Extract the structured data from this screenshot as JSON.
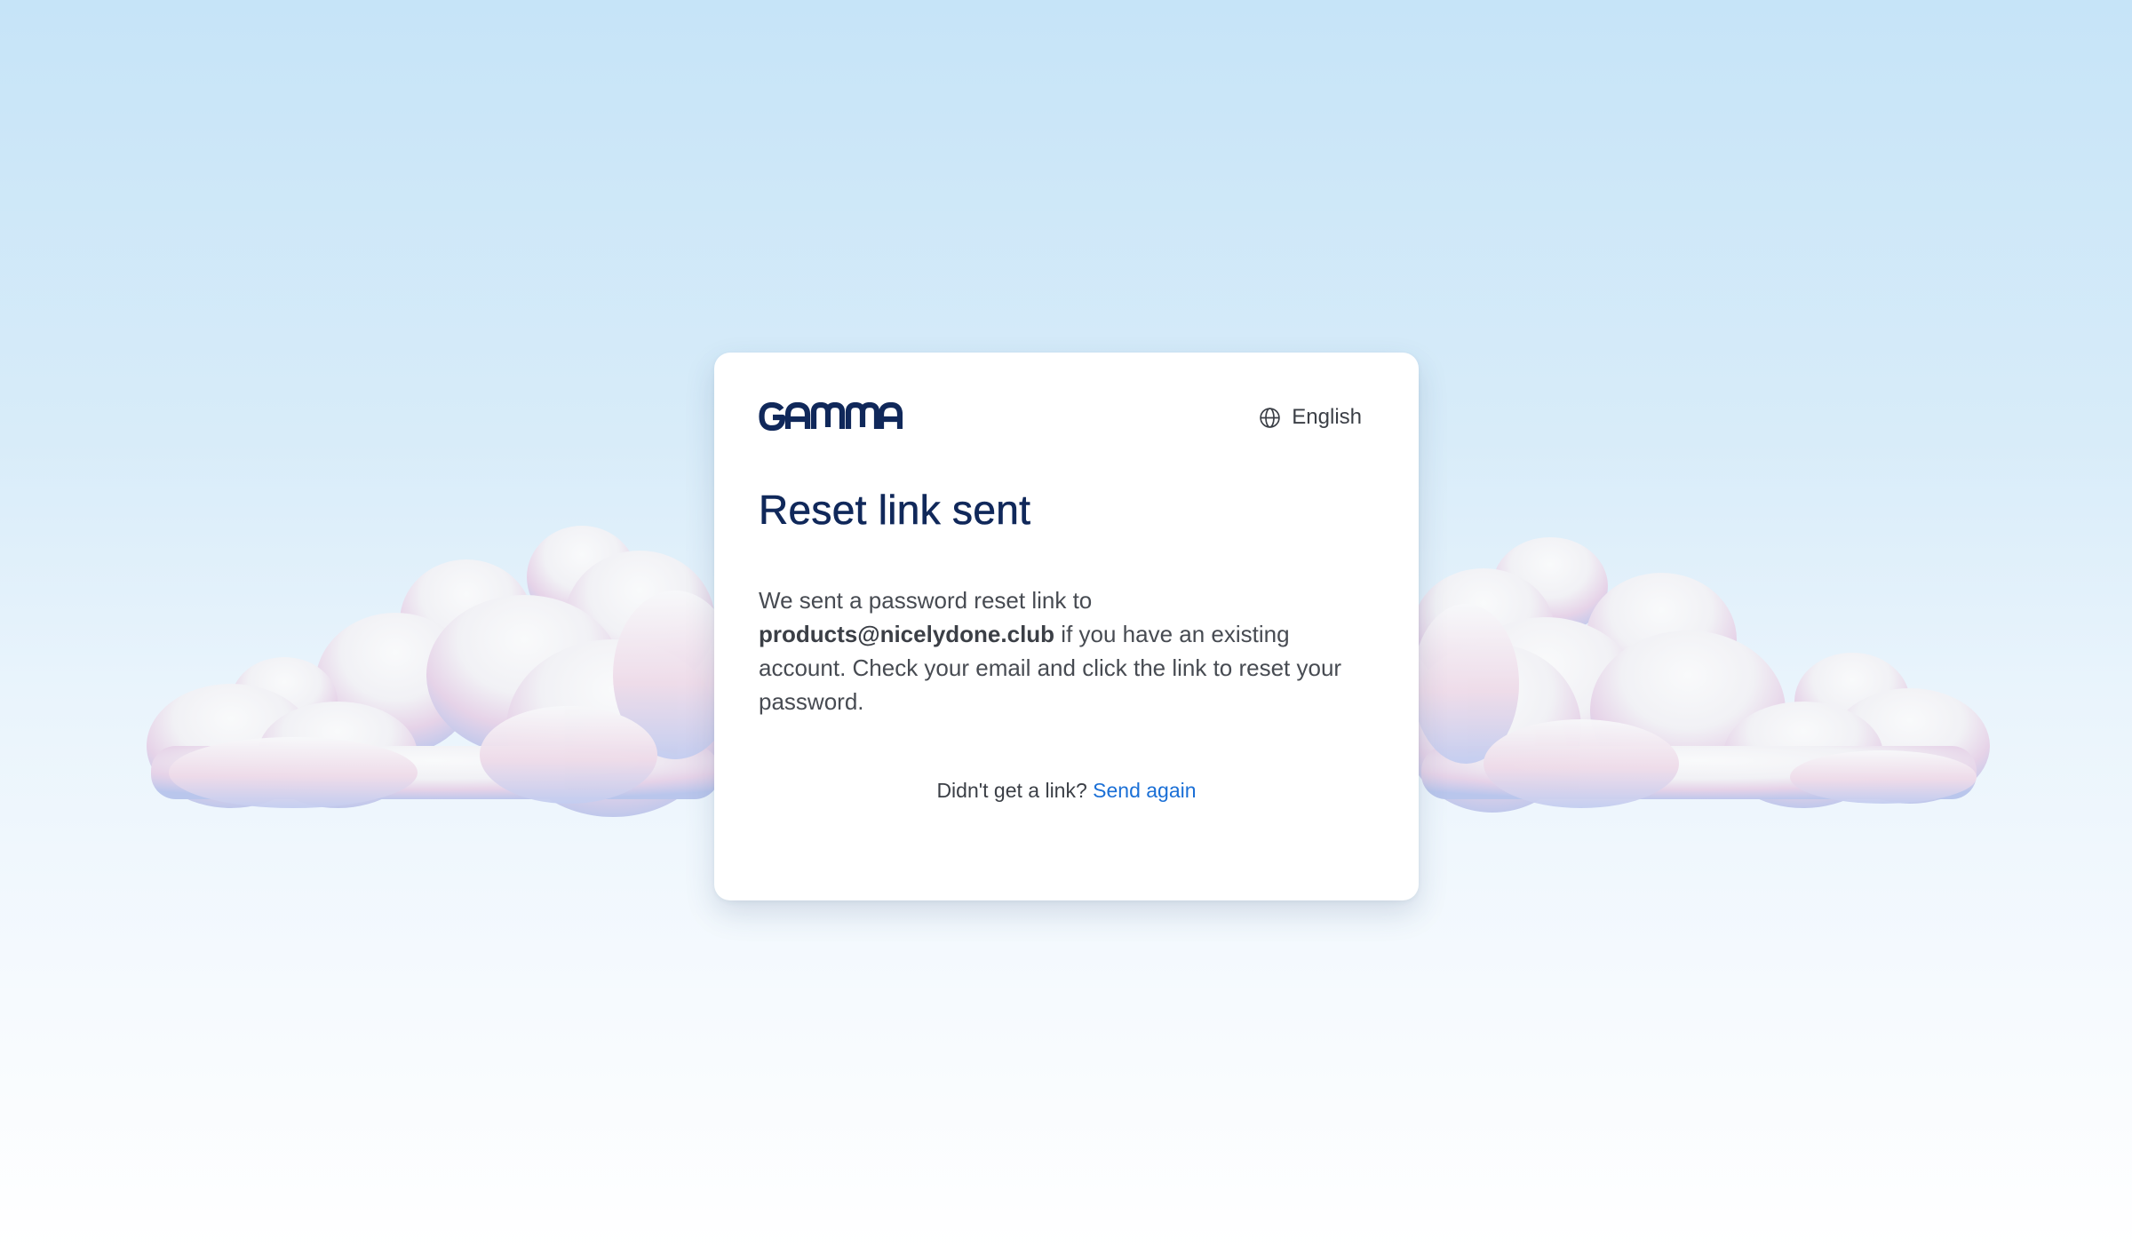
{
  "brand": {
    "name": "GAMMA",
    "color": "#10285a"
  },
  "language": {
    "icon": "globe-icon",
    "label": "English"
  },
  "heading": "Reset link sent",
  "message": {
    "prefix": "We sent a password reset link to",
    "email": "products@nicelydone.club",
    "suffix": "if you have an existing account. Check your email and click the link to reset your password."
  },
  "resend": {
    "prompt": "Didn't get a link?",
    "link_label": "Send again",
    "link_color": "#1a6fd6"
  },
  "background": {
    "sky_top": "#c6e4f8",
    "sky_bottom": "#ffffff",
    "decoration": "clouds"
  }
}
